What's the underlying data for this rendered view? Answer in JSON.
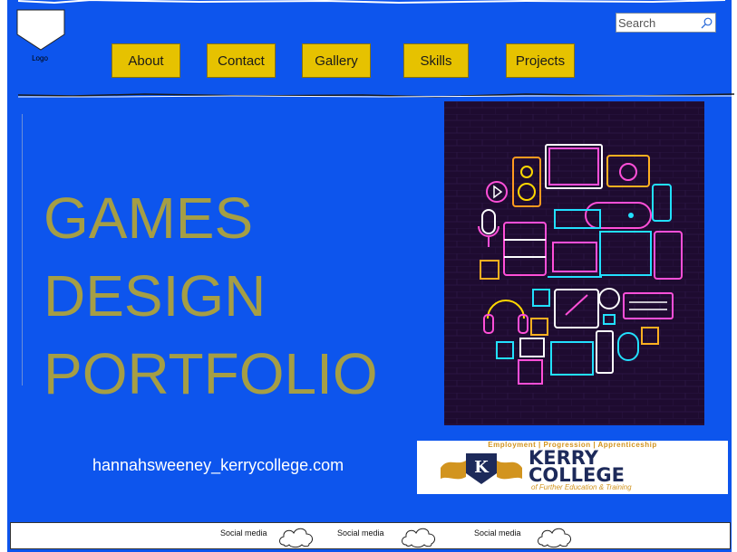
{
  "header": {
    "logo_label": "Logo",
    "search_placeholder": "Search",
    "nav": [
      {
        "label": "About"
      },
      {
        "label": "Contact"
      },
      {
        "label": "Gallery"
      },
      {
        "label": "Skills"
      },
      {
        "label": "Projects"
      }
    ]
  },
  "main": {
    "title_lines": [
      "GAMES",
      "DESIGN",
      "PORTFOLIO"
    ],
    "email": "hannahsweeney_kerrycollege.com",
    "hero_image": "neon-technology-icons-icon"
  },
  "college": {
    "tagline": "Employment | Progression | Apprenticeship",
    "name_line1": "KERRY",
    "name_line2": "COLLEGE",
    "subtitle": "of Further Education & Training"
  },
  "footer": {
    "social": [
      {
        "label": "Social media",
        "icon": "cloud-icon"
      },
      {
        "label": "Social media",
        "icon": "cloud-icon"
      },
      {
        "label": "Social media",
        "icon": "cloud-icon"
      }
    ]
  },
  "colors": {
    "background": "#0d55ed",
    "nav_button": "#e6c200",
    "title_text": "#a59e45",
    "email_text": "#ffffff"
  }
}
